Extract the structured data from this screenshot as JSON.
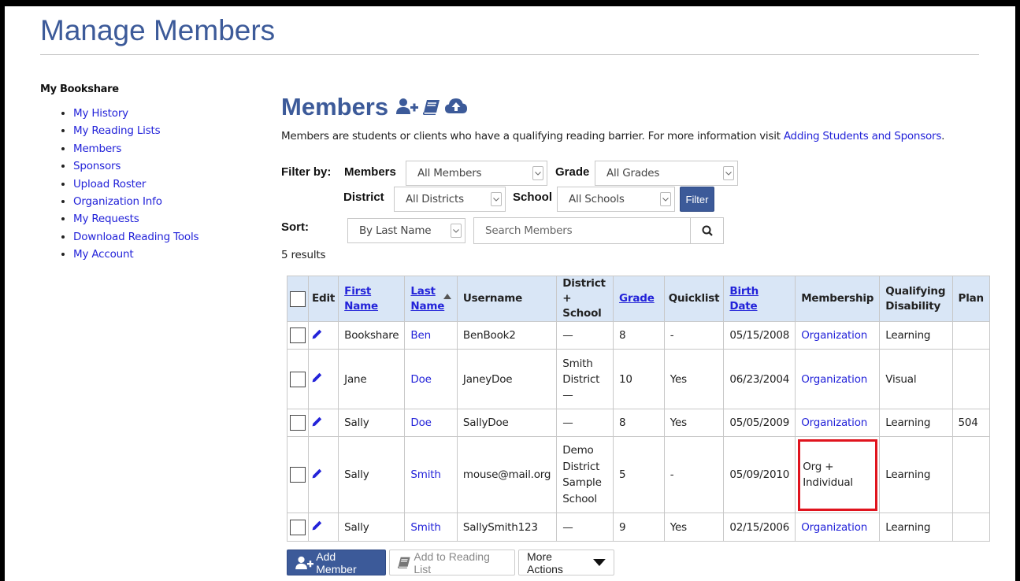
{
  "page": {
    "title": "Manage Members"
  },
  "sidebar": {
    "heading": "My Bookshare",
    "items": [
      {
        "label": "My History"
      },
      {
        "label": "My Reading Lists"
      },
      {
        "label": "Members"
      },
      {
        "label": "Sponsors"
      },
      {
        "label": "Upload Roster"
      },
      {
        "label": "Organization Info"
      },
      {
        "label": "My Requests"
      },
      {
        "label": "Download Reading Tools"
      },
      {
        "label": "My Account"
      }
    ]
  },
  "main": {
    "title": "Members",
    "title_icons": [
      "add-user-icon",
      "book-icon",
      "cloud-upload-icon"
    ],
    "intro_text": "Members are students or clients who have a qualifying reading barrier. For more information visit ",
    "intro_link": "Adding Students and Sponsors",
    "intro_end": "."
  },
  "filters": {
    "filter_by_label": "Filter by:",
    "members_label": "Members",
    "members_value": "All Members",
    "grade_label": "Grade",
    "grade_value": "All Grades",
    "district_label": "District",
    "district_value": "All Districts",
    "school_label": "School",
    "school_value": "All Schools",
    "filter_button": "Filter",
    "sort_label": "Sort:",
    "sort_value": "By Last Name",
    "search_placeholder": "Search Members",
    "results_text": "5 results"
  },
  "table": {
    "headers": {
      "edit": "Edit",
      "first_name": [
        "First",
        "Name"
      ],
      "last_name": [
        "Last",
        "Name"
      ],
      "username": "Username",
      "district_school": [
        "District +",
        "School"
      ],
      "grade": "Grade",
      "quicklist": "Quicklist",
      "birth_date": [
        "Birth",
        "Date"
      ],
      "membership": "Membership",
      "qualifying_disability": [
        "Qualifying",
        "Disability"
      ],
      "plan": "Plan"
    },
    "rows": [
      {
        "first": "Bookshare",
        "last": "Ben",
        "username": "BenBook2",
        "district_school": [
          "—"
        ],
        "grade": "8",
        "quicklist": "-",
        "birth": "05/15/2008",
        "membership": [
          "Organization"
        ],
        "membership_link": true,
        "disability": "Learning",
        "plan": ""
      },
      {
        "first": "Jane",
        "last": "Doe",
        "username": "JaneyDoe",
        "district_school": [
          "Smith",
          "District",
          "—"
        ],
        "grade": "10",
        "quicklist": "Yes",
        "birth": "06/23/2004",
        "membership": [
          "Organization"
        ],
        "membership_link": true,
        "disability": "Visual",
        "plan": ""
      },
      {
        "first": "Sally",
        "last": "Doe",
        "username": "SallyDoe",
        "district_school": [
          "—"
        ],
        "grade": "8",
        "quicklist": "Yes",
        "birth": "05/05/2009",
        "membership": [
          "Organization"
        ],
        "membership_link": true,
        "disability": "Learning",
        "plan": "504"
      },
      {
        "first": "Sally",
        "last": "Smith",
        "username": "mouse@mail.org",
        "district_school": [
          "Demo",
          "District",
          "Sample",
          "School"
        ],
        "grade": "5",
        "quicklist": "-",
        "birth": "05/09/2010",
        "membership": [
          "Org +",
          "Individual"
        ],
        "membership_link": false,
        "highlight": true,
        "disability": "Learning",
        "plan": ""
      },
      {
        "first": "Sally",
        "last": "Smith",
        "username": "SallySmith123",
        "district_school": [
          "—"
        ],
        "grade": "9",
        "quicklist": "Yes",
        "birth": "02/15/2006",
        "membership": [
          "Organization"
        ],
        "membership_link": true,
        "disability": "Learning",
        "plan": ""
      }
    ]
  },
  "actions": {
    "add_member": "Add Member",
    "add_to_reading_list": "Add to Reading List",
    "more_actions": "More Actions"
  },
  "colors": {
    "brand": "#3c5a99",
    "link": "#2323d9",
    "header_bg": "#d9e6f6",
    "highlight": "#e0141e"
  }
}
